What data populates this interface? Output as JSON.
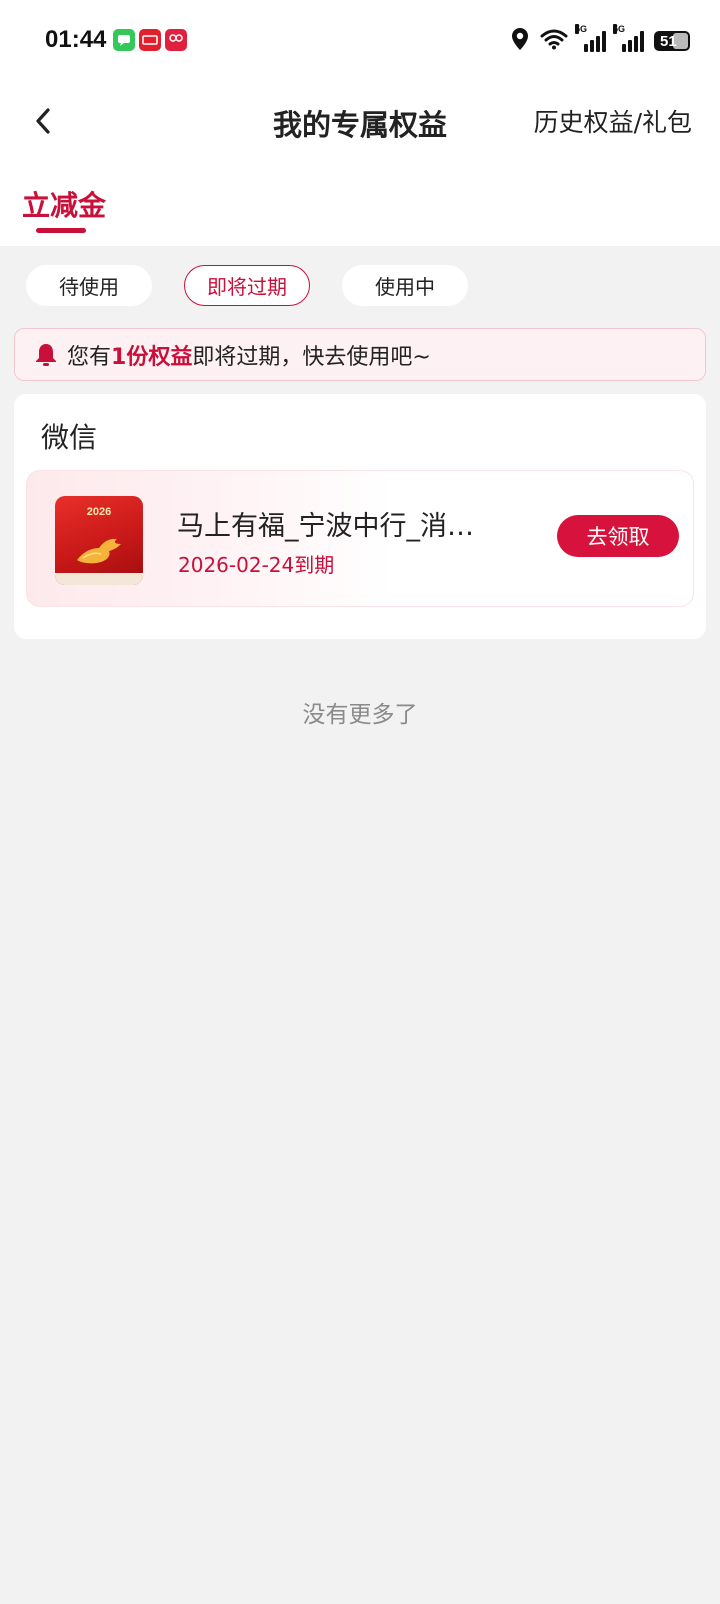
{
  "status_bar": {
    "time": "01:44",
    "apps": [
      {
        "icon": "messages-app-icon",
        "color": "#34c759"
      },
      {
        "icon": "taobao-app-icon",
        "color": "#e0202e"
      },
      {
        "icon": "shopping-app-icon",
        "color": "#e0203d"
      }
    ],
    "signal_label_1": "5G",
    "signal_label_2": "5G",
    "battery": "51"
  },
  "header": {
    "back_icon": "chevron-left-icon",
    "title": "我的专属权益",
    "history_link": "历史权益/礼包"
  },
  "category_tabs": [
    {
      "label": "立减金",
      "active": true
    }
  ],
  "filters": [
    {
      "label": "待使用",
      "active": false
    },
    {
      "label": "即将过期",
      "active": true
    },
    {
      "label": "使用中",
      "active": false
    }
  ],
  "notice": {
    "icon": "bell-icon",
    "prefix": "您有",
    "highlight": "1份权益",
    "suffix": "即将过期，快去使用吧~"
  },
  "groups": [
    {
      "title": "微信",
      "items": [
        {
          "thumb_text": "2026",
          "name": "马上有福_宁波中行_消费...",
          "expire": "2026-02-24到期",
          "action": "去领取"
        }
      ]
    }
  ],
  "footer": {
    "no_more": "没有更多了"
  },
  "colors": {
    "accent": "#c8103a",
    "button": "#d7123c",
    "background": "#f2f2f2"
  }
}
